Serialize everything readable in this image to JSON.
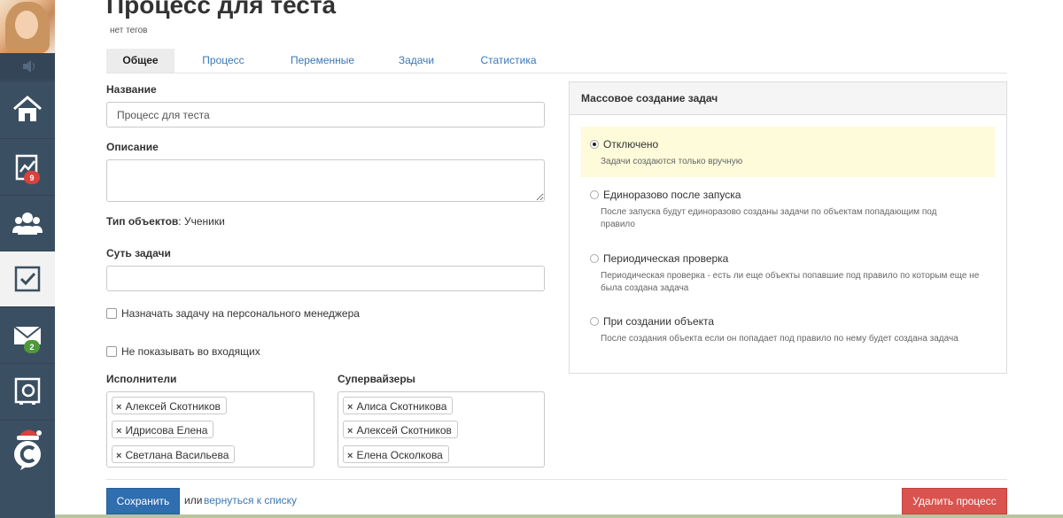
{
  "page": {
    "title": "Процесс для теста",
    "tags": "нет тегов"
  },
  "sidebar": {
    "badges": {
      "stats": "9",
      "mail": "2"
    },
    "icons": [
      "home-icon",
      "chart-icon",
      "users-icon",
      "tasks-icon",
      "mail-icon",
      "safe-icon",
      "logo-icon"
    ]
  },
  "tabs": [
    {
      "label": "Общее",
      "active": true
    },
    {
      "label": "Процесс"
    },
    {
      "label": "Переменные"
    },
    {
      "label": "Задачи"
    },
    {
      "label": "Статистика"
    }
  ],
  "form": {
    "name_label": "Название",
    "name_value": "Процесс для теста",
    "description_label": "Описание",
    "description_value": "",
    "object_type_label": "Тип объектов",
    "object_type_value": ": Ученики",
    "task_essence_label": "Суть задачи",
    "task_essence_value": "",
    "assign_manager_label": "Назначать задачу на персонального менеджера",
    "hide_inbox_label": "Не показывать во входящих",
    "executors_label": "Исполнители",
    "executors": [
      "Алексей Скотников",
      "Идрисова Елена",
      "Светлана Васильева"
    ],
    "supervisors_label": "Супервайзеры",
    "supervisors": [
      "Алиса Скотникова",
      "Алексей Скотников",
      "Елена Осколкова"
    ]
  },
  "footer": {
    "save_label": "Сохранить",
    "or_text": "или",
    "back_link": "вернуться к списку",
    "delete_label": "Удалить процесс"
  },
  "panel": {
    "title": "Массовое создание задач",
    "options": [
      {
        "label": "Отключено",
        "desc": "Задачи создаются только вручную",
        "selected": true
      },
      {
        "label": "Единоразово после запуска",
        "desc": "После запуска будут единоразово созданы задачи по объектам попадающим под правило"
      },
      {
        "label": "Периодическая проверка",
        "desc": "Периодическая проверка - есть ли еще объекты попавшие под правило по которым еще не была создана задача"
      },
      {
        "label": "При создании объекта",
        "desc": "После создания объекта если он попадает под правило по нему будет создана задача"
      }
    ]
  },
  "colors": {
    "sidebar": "#3b4f62",
    "link": "#3a78b5",
    "primary": "#2f6eaf",
    "danger": "#d9534f",
    "selected_option": "#fdfbd9"
  }
}
